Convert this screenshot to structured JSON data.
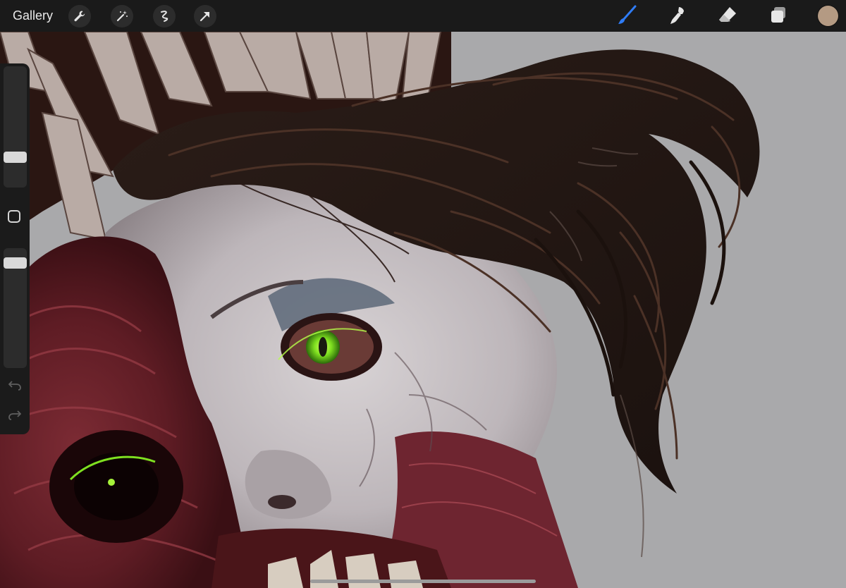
{
  "toolbar": {
    "gallery_label": "Gallery",
    "left_tools": [
      "wrench-icon",
      "magic-wand-icon",
      "selection-icon",
      "transform-arrow-icon"
    ],
    "right_tools": [
      "brush-icon",
      "smudge-icon",
      "eraser-icon",
      "layers-icon"
    ],
    "active_tool": "brush-icon",
    "accent_color": "#2f7cf6",
    "current_color": "#b49a83"
  },
  "sidebar": {
    "brush_size_level": 0.2,
    "opacity_level": 0.95
  }
}
